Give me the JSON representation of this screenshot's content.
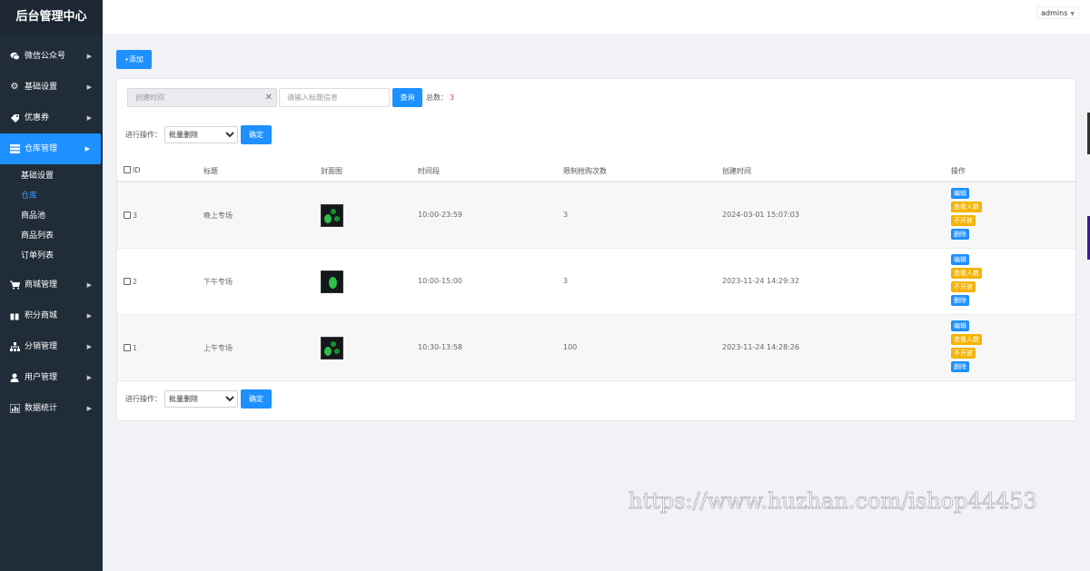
{
  "sidebar": {
    "brand": "后台管理中心",
    "items": [
      {
        "label": "微信公众号",
        "icon": "chat-icon"
      },
      {
        "label": "基础设置",
        "icon": "gear-icon"
      },
      {
        "label": "优惠券",
        "icon": "tag-icon"
      },
      {
        "label": "仓库管理",
        "icon": "server-icon",
        "active": true
      },
      {
        "label": "商城管理",
        "icon": "cart-icon"
      },
      {
        "label": "积分商城",
        "icon": "gift-icon"
      },
      {
        "label": "分销管理",
        "icon": "sitemap-icon"
      },
      {
        "label": "用户管理",
        "icon": "user-icon"
      },
      {
        "label": "数据统计",
        "icon": "bar-chart-icon"
      }
    ],
    "subitems": [
      {
        "label": "基础设置"
      },
      {
        "label": "仓库",
        "active": true
      },
      {
        "label": "商品池"
      },
      {
        "label": "商品列表"
      },
      {
        "label": "订单列表"
      }
    ]
  },
  "header": {
    "user": "admins"
  },
  "toolbar": {
    "add_label": "+添加"
  },
  "filter": {
    "date_placeholder": "创建时间",
    "title_placeholder": "请输入标题信息",
    "query_label": "查询",
    "total_label": "总数：",
    "total_count": "3"
  },
  "batch": {
    "label": "进行操作：",
    "selected": "批量删除",
    "confirm_label": "确定"
  },
  "table": {
    "columns": [
      "ID",
      "标题",
      "封面图",
      "时间段",
      "限制抢购次数",
      "创建时间",
      "操作"
    ],
    "rows": [
      {
        "id": "3",
        "title": "晚上专场",
        "time_range": "10:00-23:59",
        "limit": "3",
        "created": "2024-03-01 15:07:03"
      },
      {
        "id": "2",
        "title": "下午专场",
        "time_range": "10:00-15:00",
        "limit": "3",
        "created": "2023-11-24 14:29:32"
      },
      {
        "id": "1",
        "title": "上午专场",
        "time_range": "10:30-13:58",
        "limit": "100",
        "created": "2023-11-24 14:28:26"
      }
    ],
    "actions": {
      "edit": "编辑",
      "view_people": "查看人数",
      "not_open": "不开放",
      "delete": "删除"
    }
  },
  "watermark": "https://www.huzhan.com/ishop44453",
  "colors": {
    "sidebar_bg": "#202c38",
    "accent": "#1e90ff",
    "warning": "#f4b400",
    "count": "#e03b3b"
  }
}
